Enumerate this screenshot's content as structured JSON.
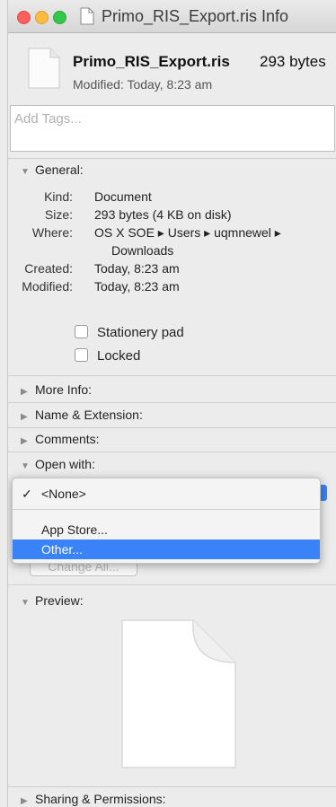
{
  "window": {
    "title": "Primo_RIS_Export.ris Info"
  },
  "header": {
    "filename": "Primo_RIS_Export.ris",
    "size": "293 bytes",
    "modified": "Modified: Today, 8:23 am"
  },
  "tags": {
    "placeholder": "Add Tags..."
  },
  "general": {
    "label": "General:",
    "kind_label": "Kind:",
    "kind": "Document",
    "size_label": "Size:",
    "size": "293 bytes (4 KB on disk)",
    "where_label": "Where:",
    "where1": "OS X SOE ▸ Users ▸ uqmnewel ▸",
    "where2": "Downloads",
    "created_label": "Created:",
    "created": "Today, 8:23 am",
    "modified_label": "Modified:",
    "modified": "Today, 8:23 am",
    "stationery": "Stationery pad",
    "locked": "Locked"
  },
  "sections": {
    "more_info": "More Info:",
    "name_ext": "Name & Extension:",
    "comments": "Comments:",
    "open_with": "Open with:",
    "preview": "Preview:",
    "sharing": "Sharing & Permissions:"
  },
  "open_with_menu": {
    "current_check": "✓",
    "current": "<None>",
    "items": [
      "App Store...",
      "Other..."
    ]
  },
  "change_all": "Change All...",
  "colors": {
    "selection": "#3a82f7"
  }
}
